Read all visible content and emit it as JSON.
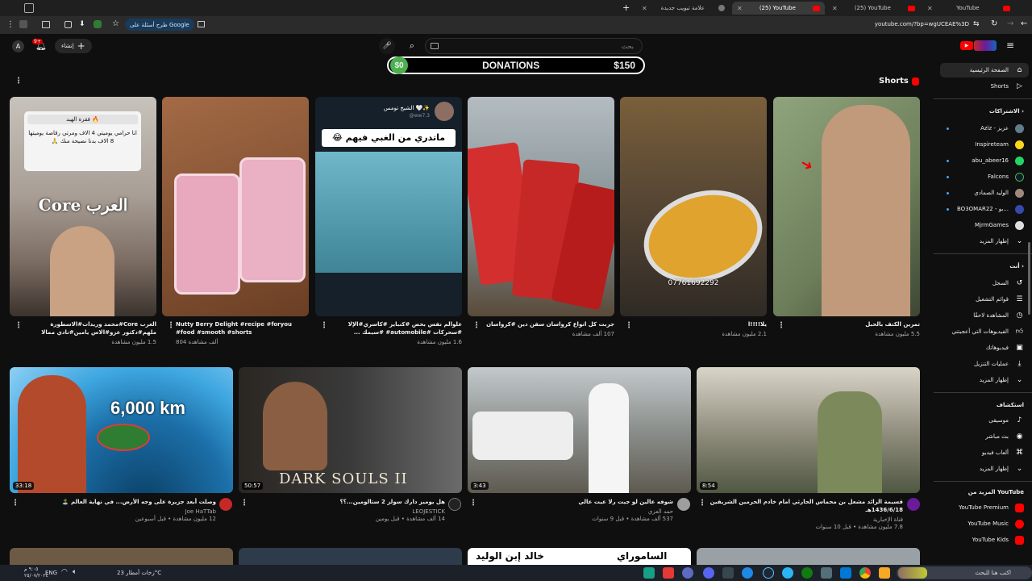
{
  "browser": {
    "tabs": [
      {
        "title": "YouTube",
        "active": false
      },
      {
        "title": "(25) YouTube",
        "active": false
      },
      {
        "title": "(25) YouTube",
        "active": true
      },
      {
        "title": "علامة تبويب جديدة",
        "active": false
      }
    ],
    "url": "youtube.com/?bp=wgUCEAE%3D",
    "google_pill": "طرح أسئلة على Google"
  },
  "youtube": {
    "search_placeholder": "بحث",
    "create_label": "إنشاء",
    "notification_count": "9+",
    "account_initial": "A"
  },
  "donation": {
    "left": "$0",
    "center": "DONATIONS",
    "right": "$150"
  },
  "sidebar": {
    "home": "الصفحة الرئيسية",
    "shorts": "Shorts",
    "subscriptions_header": "الاشتراكات",
    "subscriptions": [
      "Aziz - عزيز",
      "Inspireteam",
      "abu_abeer16",
      "Falcons",
      "الوليد الصمادي",
      "BO3OMAR22 - بو...",
      "MjrmGames"
    ],
    "show_more": "إظهار المزيد",
    "you_header": "أنت",
    "you_items": [
      "السجل",
      "قوائم التشغيل",
      "المشاهدة لاحقًا",
      "الفيديوهات التي أعجبتني",
      "فيديوهاتك",
      "عمليات التنزيل",
      "إظهار المزيد"
    ],
    "explore_header": "استكشاف",
    "explore_items": [
      "موسيقى",
      "بث مباشر",
      "ألعاب فيديو",
      "إظهار المزيد"
    ],
    "more_header": "المزيد من YouTube",
    "more_items": [
      "YouTube Premium",
      "YouTube Music",
      "YouTube Kids"
    ]
  },
  "shorts_section": {
    "title": "Shorts"
  },
  "shorts": [
    {
      "title": "تمرين الكتف بالحبل",
      "views": "5.5 مليون مشاهدة"
    },
    {
      "title": "يلا!!!!ا",
      "views": "2.1 مليون مشاهدة"
    },
    {
      "title": "جربت كل انواع كرواسان سفن دين #كرواسان",
      "views": "107 ألف مشاهدة"
    },
    {
      "title": "علوالم نفس بحض #كنبايز #كاسري#الإلا #سحركات #automobile# #سيمك ...",
      "views": "1.6 مليون مشاهدة"
    },
    {
      "title": "Nutty Berry Delight #recipe #foryou #food #smooth #shorts",
      "views": "804 ألف مشاهدة"
    },
    {
      "title": "العرب Core#محمد وريدات#الاسطورة ملهم#دكتور عزو#الاس يامين#نادي ممالا",
      "views": "1.5 مليون مشاهدة"
    }
  ],
  "videos": [
    {
      "title": "قسيمة الرائد مشعل بن محماس الحارثي امام خادم الحرمين الشريفين 1436/6/18هـ",
      "channel": "قناة الإخبارية",
      "meta": "7.8 مليون مشاهدة • قبل 10 سنوات",
      "duration": "8:54"
    },
    {
      "title": "شوفه عالين لو جيت رلا عيت عالي",
      "channel": "حمد العزي",
      "meta": "537 ألف مشاهدة • قبل 9 سنوات",
      "duration": "3:43"
    },
    {
      "title": "هل يوميز دارك سولز 2 ستالومين...؟؟",
      "channel": "LEOJESTICK",
      "meta": "14 ألف مشاهدة • قبل يومين",
      "duration": "50:57"
    },
    {
      "title": "وصلت أبعد جزيرة على وجه الأرض... في نهاية العالم 🏝️",
      "channel": "Joe HaTTab",
      "meta": "12 مليون مشاهدة • قبل أسبوعين",
      "duration": "33:18"
    }
  ],
  "thumb_text": {
    "arab_core": "العرب Core",
    "caption_header": "فقرة الهبد 🔥",
    "caption_body": "انا حرامي يوميتي 4 الاف ومرتي رقاصة يوميتها 8 الاف بدنا نصيحة منك 🙏",
    "tweet_name": "الشيخ تومس 🤍✨",
    "tweet_handle": "@ww7.3",
    "tweet_text": "ماتدري من الغبي فيهم 😂",
    "phone": "07761692292",
    "island_km": "6,000 km",
    "dark_souls": "DARK SOULS II",
    "bottom1": "خالد إبن الوليد",
    "bottom2": "الساموراي"
  },
  "taskbar": {
    "weather": "زخات أمطار 23°C",
    "lang": "ENG",
    "time": "٩:٠٥ م",
    "date": "٢٥/٠٧/٢٠٢٤",
    "search": "اكتب هنا للبحث"
  }
}
